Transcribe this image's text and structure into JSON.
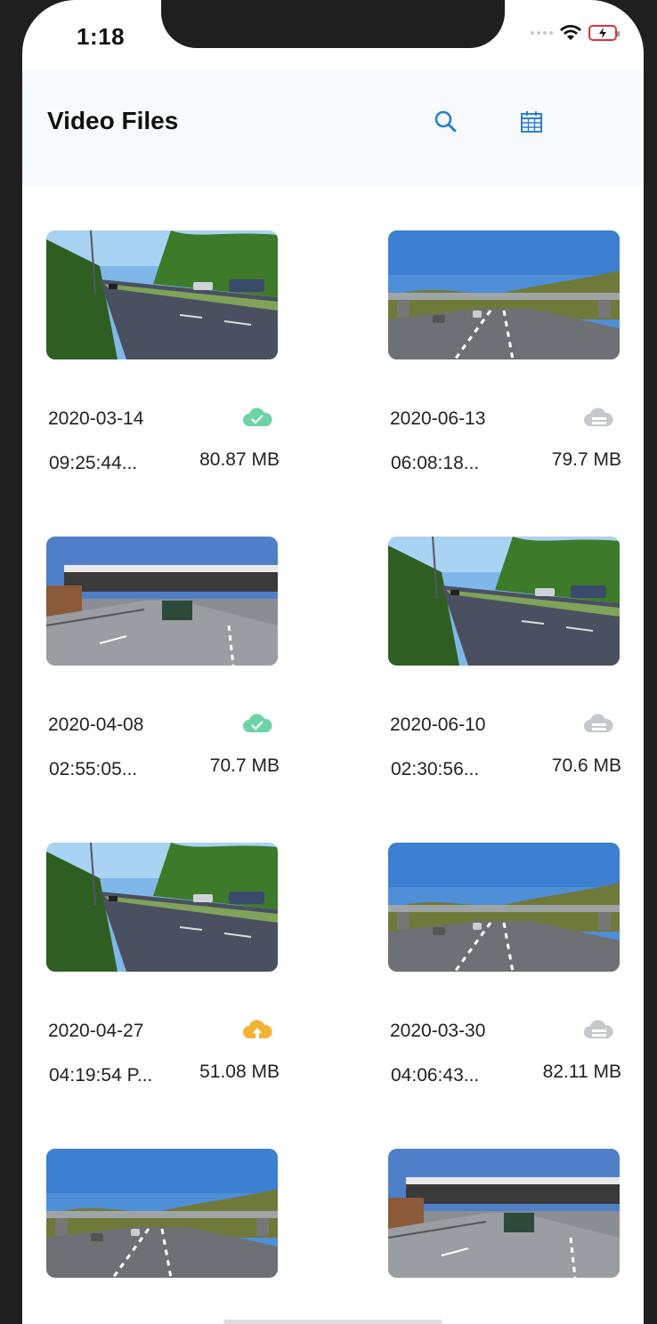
{
  "status": {
    "time": "1:18"
  },
  "header": {
    "title": "Video Files"
  },
  "colors": {
    "synced": "#6fd3a8",
    "uploading": "#f2b233",
    "pending": "#c5c9cc",
    "accent": "#2a7fd0"
  },
  "files": [
    {
      "date": "2020-03-14",
      "time": "09:25:44...",
      "size": "80.87 MB",
      "cloud": "synced-cloud-icon",
      "scene": "road"
    },
    {
      "date": "2020-06-13",
      "time": "06:08:18...",
      "size": "79.7 MB",
      "cloud": "pending-cloud-icon",
      "scene": "bridge"
    },
    {
      "date": "2020-04-08",
      "time": "02:55:05...",
      "size": "70.7 MB",
      "cloud": "synced-cloud-icon",
      "scene": "bridge2"
    },
    {
      "date": "2020-06-10",
      "time": "02:30:56...",
      "size": "70.6 MB",
      "cloud": "pending-cloud-icon",
      "scene": "road"
    },
    {
      "date": "2020-04-27",
      "time": "04:19:54 P...",
      "size": "51.08 MB",
      "cloud": "upload-cloud-icon",
      "scene": "road"
    },
    {
      "date": "2020-03-30",
      "time": "04:06:43...",
      "size": "82.11 MB",
      "cloud": "pending-cloud-icon",
      "scene": "bridge"
    },
    {
      "date": "",
      "time": "",
      "size": "",
      "cloud": "",
      "scene": "bridge"
    },
    {
      "date": "",
      "time": "",
      "size": "",
      "cloud": "",
      "scene": "bridge2"
    }
  ]
}
